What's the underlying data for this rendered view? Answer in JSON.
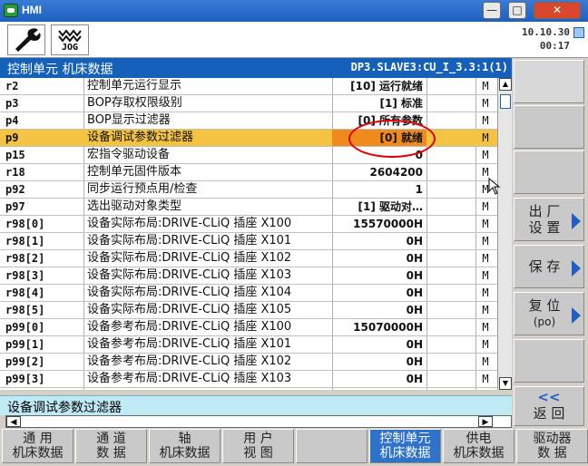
{
  "window": {
    "title": "HMI",
    "minimize": "—",
    "maximize": "□",
    "close": "✕"
  },
  "toolbar": {
    "jog_label": "JOG"
  },
  "clock": {
    "date": "10.10.30",
    "time": "00:17"
  },
  "header": {
    "title": "控制单元 机床数据",
    "path": "DP3.SLAVE3:CU_I_3.3:1(1)"
  },
  "table": {
    "rows": [
      {
        "id": "r2",
        "desc": "控制单元运行显示",
        "value": "[10] 运行就绪",
        "m": "M"
      },
      {
        "id": "p3",
        "desc": "BOP存取权限级别",
        "value": "[1] 标准",
        "m": "M"
      },
      {
        "id": "p4",
        "desc": "BOP显示过滤器",
        "value": "[0] 所有参数",
        "m": "M"
      },
      {
        "id": "p9",
        "desc": "设备调试参数过滤器",
        "value": "[0] 就绪",
        "m": "M"
      },
      {
        "id": "p15",
        "desc": "宏指令驱动设备",
        "value": "0",
        "m": "M"
      },
      {
        "id": "r18",
        "desc": "控制单元固件版本",
        "value": "2604200",
        "m": "M"
      },
      {
        "id": "p92",
        "desc": "同步运行预点用/检查",
        "value": "1",
        "m": "M"
      },
      {
        "id": "p97",
        "desc": "选出驱动对象类型",
        "value": "[1] 驱动对…",
        "m": "M"
      },
      {
        "id": "r98[0]",
        "desc": "设备实际布局:DRIVE-CLiQ 插座 X100",
        "value": "15570000H",
        "m": "M"
      },
      {
        "id": "r98[1]",
        "desc": "设备实际布局:DRIVE-CLiQ 插座 X101",
        "value": "0H",
        "m": "M"
      },
      {
        "id": "r98[2]",
        "desc": "设备实际布局:DRIVE-CLiQ 插座 X102",
        "value": "0H",
        "m": "M"
      },
      {
        "id": "r98[3]",
        "desc": "设备实际布局:DRIVE-CLiQ 插座 X103",
        "value": "0H",
        "m": "M"
      },
      {
        "id": "r98[4]",
        "desc": "设备实际布局:DRIVE-CLiQ 插座 X104",
        "value": "0H",
        "m": "M"
      },
      {
        "id": "r98[5]",
        "desc": "设备实际布局:DRIVE-CLiQ 插座 X105",
        "value": "0H",
        "m": "M"
      },
      {
        "id": "p99[0]",
        "desc": "设备参考布局:DRIVE-CLiQ 插座 X100",
        "value": "15070000H",
        "m": "M"
      },
      {
        "id": "p99[1]",
        "desc": "设备参考布局:DRIVE-CLiQ 插座 X101",
        "value": "0H",
        "m": "M"
      },
      {
        "id": "p99[2]",
        "desc": "设备参考布局:DRIVE-CLiQ 插座 X102",
        "value": "0H",
        "m": "M"
      },
      {
        "id": "p99[3]",
        "desc": "设备参考布局:DRIVE-CLiQ 插座 X103",
        "value": "0H",
        "m": "M"
      }
    ]
  },
  "status": {
    "text": "设备调试参数过滤器"
  },
  "scroll": {
    "up": "▲",
    "down": "▼",
    "left": "◀",
    "right": "▶"
  },
  "softkeys": {
    "factory_line1": "出 厂",
    "factory_line2": "设 置",
    "save": "保 存",
    "reset_line1": "复 位",
    "reset_line2": "(po)",
    "back_symbol": "<<",
    "back": "返 回"
  },
  "bottom_keys": [
    {
      "l1": "通  用",
      "l2": "机床数据"
    },
    {
      "l1": "通 道",
      "l2": "数 据"
    },
    {
      "l1": "轴",
      "l2": "机床数据"
    },
    {
      "l1": "用 户",
      "l2": "视 图"
    },
    {
      "l1": "",
      "l2": ""
    },
    {
      "l1": "控制单元",
      "l2": "机床数据"
    },
    {
      "l1": "供电",
      "l2": "机床数据"
    },
    {
      "l1": "驱动器",
      "l2": "数 据"
    }
  ],
  "colors": {
    "header": "#1560b8",
    "selected_row": "#f5c342",
    "selected_value": "#f08a1c",
    "highlight_circle": "#e00000",
    "active_key": "#2e72c9"
  }
}
